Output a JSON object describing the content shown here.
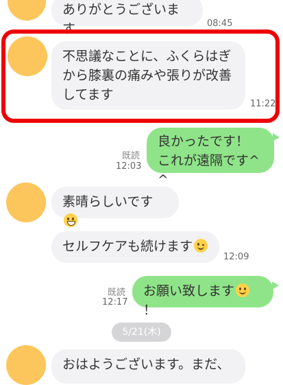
{
  "messages": [
    {
      "text": "ありがとうございます",
      "time": "08:45"
    },
    {
      "text": "不思議なことに、ふくらはぎ\nから膝裏の痛みや張りが改善\nしてます",
      "time": "11:22"
    },
    {
      "text": "良かったです！\nこれが遠隔です^ ^",
      "time": "12:03",
      "read": "既読"
    },
    {
      "text": "素晴らしいです",
      "emoji": "grinning-face"
    },
    {
      "text": "セルフケアも続けます",
      "emoji": "winking-face",
      "time": "12:09"
    },
    {
      "text": "お願い致します",
      "emoji": "smiling-face",
      "suffix": "！",
      "time": "12:17",
      "read": "既読"
    },
    {
      "text": "おはようございます。まだ、"
    }
  ],
  "date_separator": "5/21(木)",
  "colors": {
    "avatar": "#fdc65c",
    "incoming_bubble": "#f2f2f4",
    "outgoing_bubble": "#8fe388",
    "highlight": "#ee0000"
  }
}
